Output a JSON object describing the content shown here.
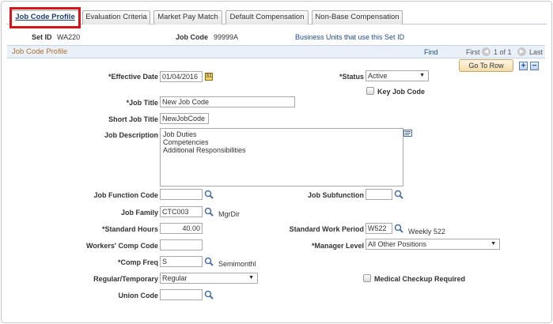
{
  "tabs": [
    {
      "label": "Job Code Profile",
      "active": true
    },
    {
      "label": "Evaluation Criteria"
    },
    {
      "label": "Market Pay Match"
    },
    {
      "label": "Default Compensation"
    },
    {
      "label": "Non-Base Compensation"
    }
  ],
  "header": {
    "setid_label": "Set ID",
    "setid_value": "WA220",
    "jobcode_label": "Job Code",
    "jobcode_value": "99999A",
    "bu_link": "Business Units that use this Set ID"
  },
  "section": {
    "title": "Job Code Profile",
    "find": "Find",
    "first": "First",
    "pager": "1 of 1",
    "last": "Last",
    "goto_row": "Go To Row",
    "add": "+",
    "remove": "−"
  },
  "form": {
    "effective_date_label": "*Effective Date",
    "effective_date": "01/04/2016",
    "status_label": "*Status",
    "status": "Active",
    "key_job_code_label": "Key Job Code",
    "key_job_code": false,
    "job_title_label": "*Job Title",
    "job_title": "New Job Code",
    "short_title_label": "Short Job Title",
    "short_title": "NewJobCode",
    "description_label": "Job Description",
    "description_lines": [
      "Job Duties",
      "Competencies",
      "Additional Responsibilities"
    ],
    "job_function_label": "Job Function Code",
    "job_function": "",
    "job_subfunction_label": "Job Subfunction",
    "job_subfunction": "",
    "job_family_label": "Job Family",
    "job_family": "CTC003",
    "job_family_desc": "MgrDir",
    "std_hours_label": "*Standard Hours",
    "std_hours": "40.00",
    "std_work_period_label": "Standard Work Period",
    "std_work_period": "W522",
    "std_work_period_desc": "Weekly 522",
    "workers_comp_label": "Workers' Comp Code",
    "workers_comp": "",
    "manager_level_label": "*Manager Level",
    "manager_level": "All Other Positions",
    "comp_freq_label": "*Comp Freq",
    "comp_freq": "S",
    "comp_freq_desc": "Semimonthl",
    "reg_temp_label": "Regular/Temporary",
    "reg_temp": "Regular",
    "medical_label": "Medical Checkup Required",
    "medical": false,
    "union_label": "Union Code",
    "union": ""
  },
  "colors": {
    "section_title": "#b0712a",
    "link": "#1e4b8f",
    "highlight": "#d8141b"
  }
}
